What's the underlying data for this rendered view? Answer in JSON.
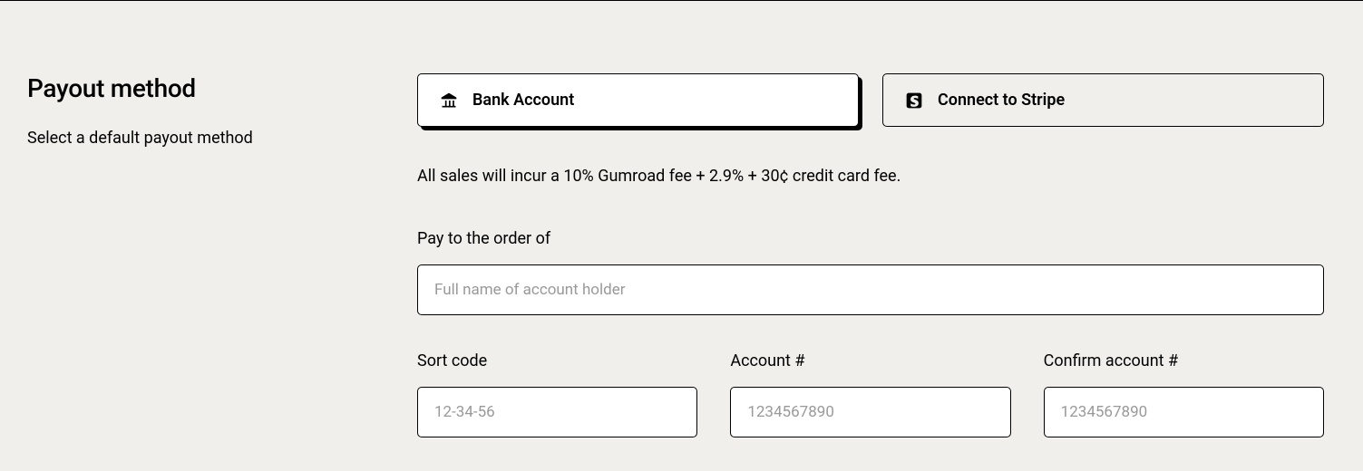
{
  "header": {
    "title": "Payout method",
    "subtitle": "Select a default payout method"
  },
  "methods": {
    "bank": {
      "label": "Bank Account"
    },
    "stripe": {
      "label": "Connect to Stripe"
    }
  },
  "feeNotice": "All sales will incur a 10% Gumroad fee + 2.9% + 30¢ credit card fee.",
  "form": {
    "payTo": {
      "label": "Pay to the order of",
      "placeholder": "Full name of account holder",
      "value": ""
    },
    "sortCode": {
      "label": "Sort code",
      "placeholder": "12-34-56",
      "value": ""
    },
    "account": {
      "label": "Account #",
      "placeholder": "1234567890",
      "value": ""
    },
    "confirmAccount": {
      "label": "Confirm account #",
      "placeholder": "1234567890",
      "value": ""
    }
  }
}
